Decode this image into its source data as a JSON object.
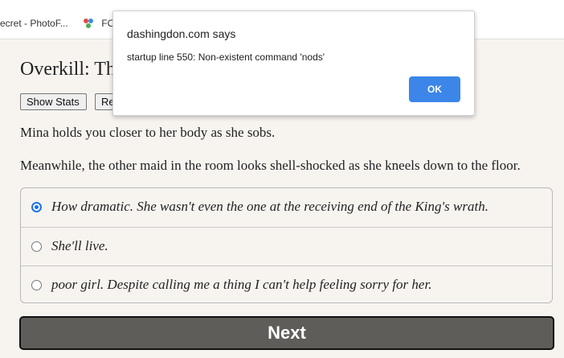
{
  "bookmarks": {
    "item1": "ecret - PhotoF...",
    "item2": "FO"
  },
  "game": {
    "title": "Overkill: Th",
    "show_stats_label": "Show Stats",
    "restart_label": "Re",
    "paragraphs": [
      "Mina holds you closer to her body as she sobs.",
      "Meanwhile, the other maid in the room looks shell-shocked as she kneels down to the floor."
    ],
    "choices": [
      {
        "label": "How dramatic. She wasn't even the one at the receiving end of the King's wrath.",
        "selected": true
      },
      {
        "label": "She'll live.",
        "selected": false
      },
      {
        "label": "poor girl. Despite calling me a thing I can't help feeling sorry for her.",
        "selected": false
      }
    ],
    "next_label": "Next"
  },
  "dialog": {
    "title": "dashingdon.com says",
    "message": "startup line 550: Non-existent command 'nods'",
    "ok_label": "OK"
  },
  "colors": {
    "accent": "#1a73e8",
    "ok_button": "#3b86e8",
    "next_button": "#5f5d5a",
    "page_bg": "#f7f4f0"
  }
}
